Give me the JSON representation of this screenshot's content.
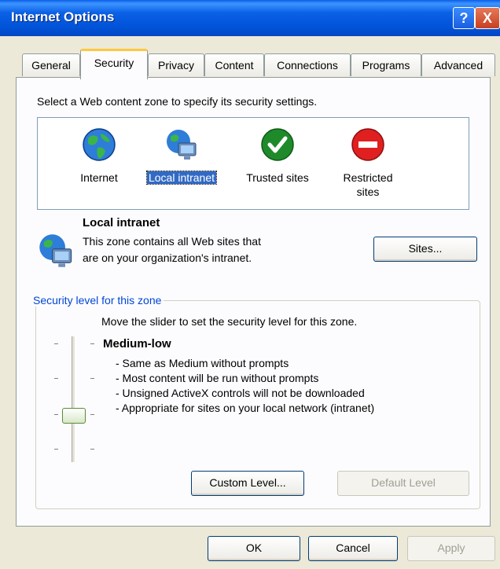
{
  "window": {
    "title": "Internet Options",
    "help": "?",
    "close": "X"
  },
  "tabs": [
    "General",
    "Security",
    "Privacy",
    "Content",
    "Connections",
    "Programs",
    "Advanced"
  ],
  "security": {
    "intro": "Select a Web content zone to specify its security settings.",
    "zones": [
      {
        "label": "Internet",
        "icon": "globe-icon"
      },
      {
        "label": "Local intranet",
        "icon": "intranet-globe-icon",
        "selected": true
      },
      {
        "label": "Trusted sites",
        "icon": "checkmark-icon"
      },
      {
        "label": "Restricted",
        "label2": "sites",
        "icon": "no-entry-icon"
      }
    ],
    "zone_title": "Local intranet",
    "zone_desc_1": "This zone contains all Web sites that",
    "zone_desc_2": "are on your organization's intranet.",
    "sites_button": "Sites...",
    "level_group": "Security level for this zone",
    "slider_instruction": "Move the slider to set the security level for this zone.",
    "level_name": "Medium-low",
    "level_points": [
      "- Same as Medium without prompts",
      "- Most content will be run without prompts",
      "- Unsigned ActiveX controls will not be downloaded",
      "- Appropriate for sites on your local network (intranet)"
    ],
    "custom_level": "Custom Level...",
    "default_level": "Default Level"
  },
  "buttons": {
    "ok": "OK",
    "cancel": "Cancel",
    "apply": "Apply"
  },
  "colors": {
    "titlebar": "#0153D8",
    "selection": "#316AC5",
    "groupTitle": "#0046D5",
    "tabHighlight": "#FFC83C"
  }
}
